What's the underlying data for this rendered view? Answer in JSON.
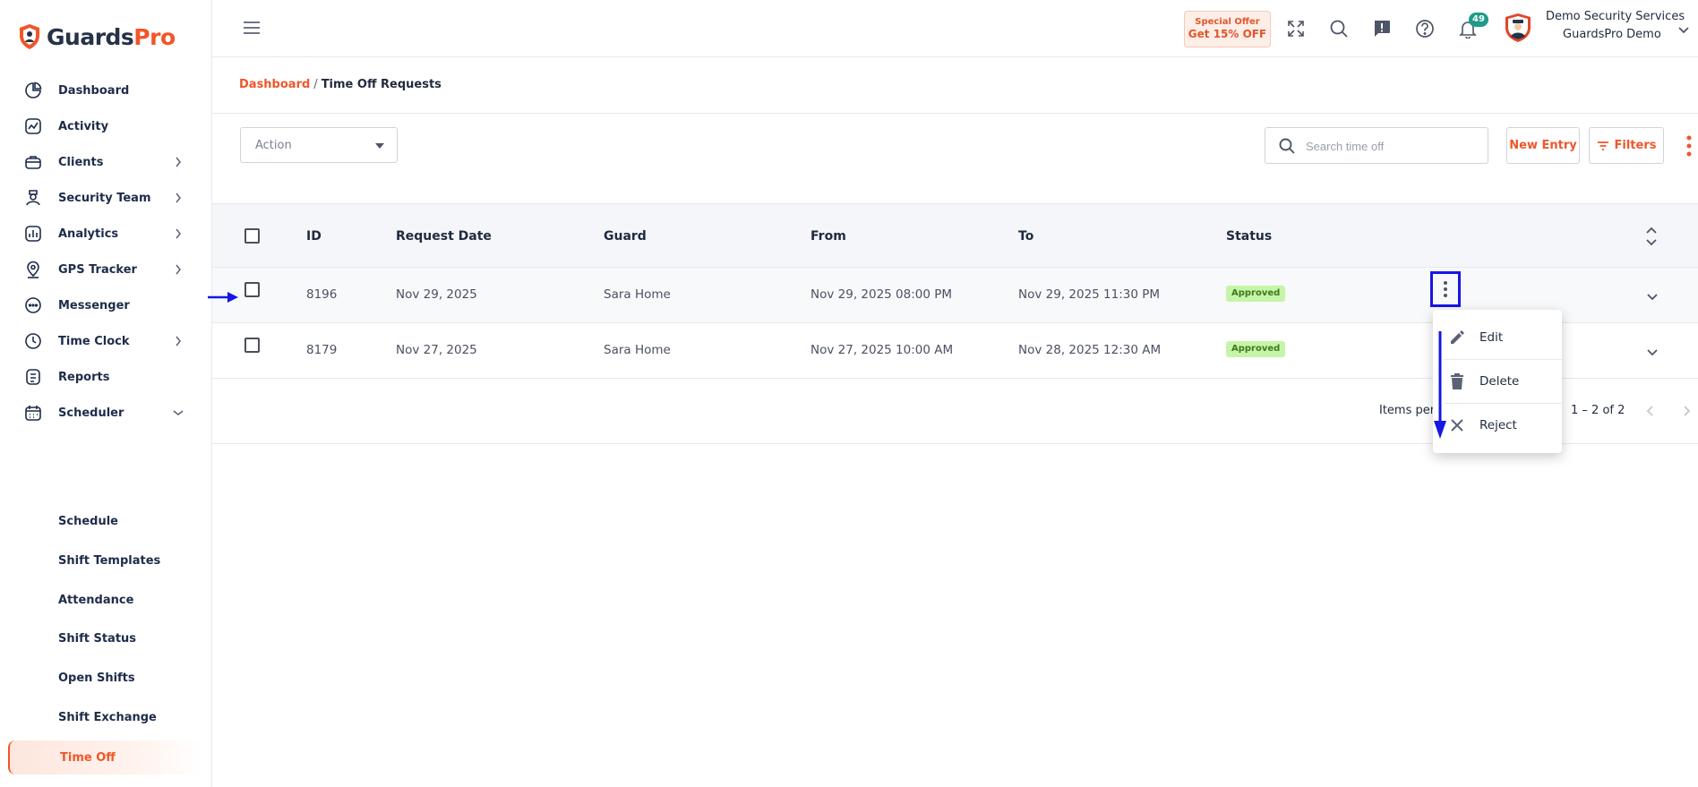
{
  "brand": {
    "name_part1": "Guards",
    "name_part2": "Pro",
    "accent": "#f0562a",
    "dark": "#263246"
  },
  "sidebar": {
    "items": [
      {
        "label": "Dashboard",
        "icon": "pie-chart-icon",
        "has_chevron": false
      },
      {
        "label": "Activity",
        "icon": "activity-chart-icon",
        "has_chevron": false
      },
      {
        "label": "Clients",
        "icon": "briefcase-icon",
        "has_chevron": true
      },
      {
        "label": "Security Team",
        "icon": "guard-icon",
        "has_chevron": true
      },
      {
        "label": "Analytics",
        "icon": "bar-chart-icon",
        "has_chevron": true
      },
      {
        "label": "GPS Tracker",
        "icon": "map-pin-icon",
        "has_chevron": true
      },
      {
        "label": "Messenger",
        "icon": "chat-bubble-icon",
        "has_chevron": false
      },
      {
        "label": "Time Clock",
        "icon": "clock-icon",
        "has_chevron": true
      },
      {
        "label": "Reports",
        "icon": "document-icon",
        "has_chevron": false
      },
      {
        "label": "Scheduler",
        "icon": "calendar-icon",
        "has_chevron": true,
        "expanded": true
      }
    ],
    "subitems": [
      {
        "label": "Schedule"
      },
      {
        "label": "Shift Templates"
      },
      {
        "label": "Attendance"
      },
      {
        "label": "Shift Status"
      },
      {
        "label": "Open Shifts"
      },
      {
        "label": "Shift Exchange"
      },
      {
        "label": "Time Off",
        "active": true
      }
    ]
  },
  "header": {
    "offer_line1": "Special Offer",
    "offer_line2": "Get 15% OFF",
    "notification_count": "49",
    "company": "Demo Security Services",
    "user": "GuardsPro Demo"
  },
  "breadcrumb": {
    "home": "Dashboard",
    "separator": "/",
    "current": "Time Off Requests"
  },
  "toolbar": {
    "action_label": "Action",
    "search_placeholder": "Search time off",
    "new_entry_label": "New Entry",
    "filters_label": "Filters"
  },
  "table": {
    "columns": [
      "ID",
      "Request Date",
      "Guard",
      "From",
      "To",
      "Status"
    ],
    "rows": [
      {
        "id": "8196",
        "request_date": "Nov 29, 2025",
        "guard": "Sara Home",
        "from": "Nov 29, 2025 08:00 PM",
        "to": "Nov 29, 2025 11:30 PM",
        "status": "Approved"
      },
      {
        "id": "8179",
        "request_date": "Nov 27, 2025",
        "guard": "Sara Home",
        "from": "Nov 27, 2025 10:00 AM",
        "to": "Nov 28, 2025 12:30 AM",
        "status": "Approved"
      }
    ]
  },
  "paginator": {
    "label": "Items per p",
    "range": "1 – 2 of 2"
  },
  "row_menu": {
    "items": [
      {
        "label": "Edit",
        "icon": "pencil-icon"
      },
      {
        "label": "Delete",
        "icon": "trash-icon"
      },
      {
        "label": "Reject",
        "icon": "close-icon"
      }
    ]
  },
  "colors": {
    "status_bg": "#c6f4a8",
    "status_text": "#3d7a1b",
    "annotation": "#1616e6",
    "badge": "#1f9a8a"
  }
}
